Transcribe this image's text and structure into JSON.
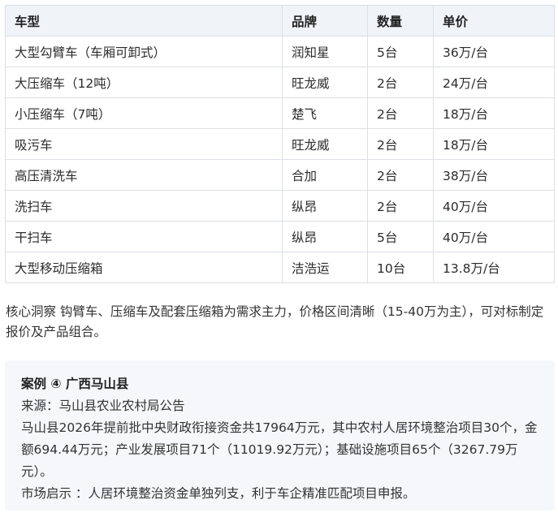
{
  "table": {
    "headers": [
      "车型",
      "品牌",
      "数量",
      "单价"
    ],
    "rows": [
      [
        "大型勾臂车（车厢可卸式）",
        "润知星",
        "5台",
        "36万/台"
      ],
      [
        "大压缩车（12吨）",
        "旺龙威",
        "2台",
        "24万/台"
      ],
      [
        "小压缩车（7吨）",
        "楚飞",
        "2台",
        "18万/台"
      ],
      [
        "吸污车",
        "旺龙威",
        "2台",
        "18万/台"
      ],
      [
        "高压清洗车",
        "合加",
        "2台",
        "38万/台"
      ],
      [
        "洗扫车",
        "纵昂",
        "2台",
        "40万/台"
      ],
      [
        "干扫车",
        "纵昂",
        "5台",
        "40万/台"
      ],
      [
        "大型移动压缩箱",
        "洁浩运",
        "10台",
        "13.8万/台"
      ]
    ]
  },
  "insight": {
    "text": "核心洞察 钩臂车、压缩车及配套压缩箱为需求主力，价格区间清晰（15-40万为主），可对标制定报价及产品组合。"
  },
  "case": {
    "title": "案例 ④ 广西马山县",
    "source": "来源：马山县农业农村局公告",
    "body": "马山县2026年提前批中央财政衔接资金共17964万元，其中农村人居环境整治项目30个，金额694.44万元；产业发展项目71个（11019.92万元）；基础设施项目65个（3267.79万元）。",
    "hint": "市场启示 ：人居环境整治资金单独列支，利于车企精准匹配项目申报。"
  }
}
